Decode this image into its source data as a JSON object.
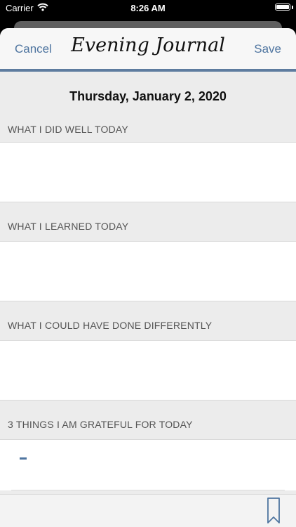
{
  "status_bar": {
    "carrier": "Carrier",
    "time": "8:26 AM"
  },
  "nav": {
    "cancel_label": "Cancel",
    "title": "Evening Journal",
    "save_label": "Save"
  },
  "date": "Thursday, January 2, 2020",
  "sections": [
    {
      "header": "WHAT I DID WELL TODAY",
      "value": ""
    },
    {
      "header": "WHAT I LEARNED TODAY",
      "value": ""
    },
    {
      "header": "WHAT I COULD HAVE DONE DIFFERENTLY",
      "value": ""
    },
    {
      "header": "3 THINGS I AM GRATEFUL FOR TODAY",
      "items": [
        "-"
      ]
    }
  ],
  "colors": {
    "accent": "#4f75a0",
    "divider": "#5e7c9f",
    "background": "#ececec"
  },
  "icons": {
    "toolbar": "bookmark-icon",
    "status": [
      "wifi-icon",
      "battery-icon"
    ]
  }
}
